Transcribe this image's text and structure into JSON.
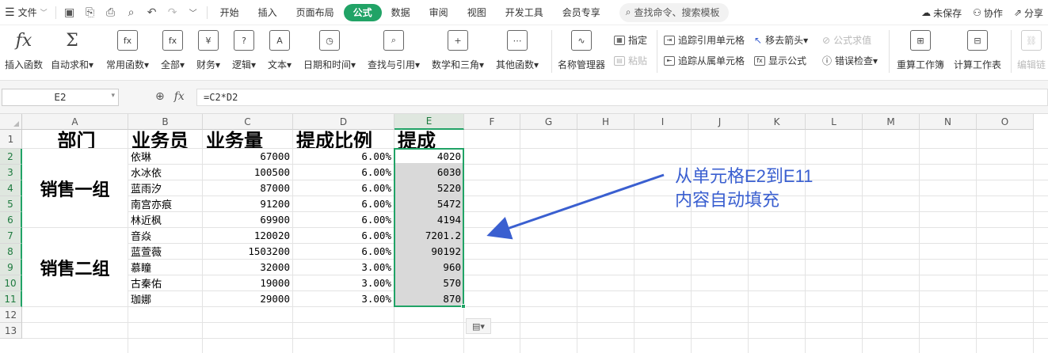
{
  "menubar": {
    "file_label": "文件",
    "tabs": [
      "开始",
      "插入",
      "页面布局",
      "公式",
      "数据",
      "审阅",
      "视图",
      "开发工具",
      "会员专享"
    ],
    "active_tab": "公式",
    "search_placeholder": "查找命令、搜索模板",
    "unsaved_label": "未保存",
    "collab_label": "协作",
    "share_label": "分享"
  },
  "ribbon": {
    "insert_function": "插入函数",
    "autosum": "自动求和",
    "common_functions": "常用函数",
    "all": "全部",
    "finance": "财务",
    "logic": "逻辑",
    "text": "文本",
    "datetime": "日期和时间",
    "lookup": "查找与引用",
    "math": "数学和三角",
    "other": "其他函数",
    "name_manager": "名称管理器",
    "assign": "指定",
    "paste": "粘贴",
    "trace_precedents": "追踪引用单元格",
    "trace_dependents": "追踪从属单元格",
    "remove_arrows": "移去箭头",
    "show_formulas": "显示公式",
    "eval_formula": "公式求值",
    "error_check": "错误检查",
    "recalc_workbook": "重算工作簿",
    "calc_sheet": "计算工作表",
    "edit_links": "编辑链"
  },
  "formula_bar": {
    "name_box": "E2",
    "formula": "=C2*D2"
  },
  "columns": [
    "A",
    "B",
    "C",
    "D",
    "E",
    "F",
    "G",
    "H",
    "I",
    "J",
    "K",
    "L",
    "M",
    "N",
    "O"
  ],
  "rows": [
    "1",
    "2",
    "3",
    "4",
    "5",
    "6",
    "7",
    "8",
    "9",
    "10",
    "11",
    "12",
    "13"
  ],
  "sheet": {
    "headers": [
      "部门",
      "业务员",
      "业务量",
      "提成比例",
      "提成"
    ],
    "groups": [
      "销售一组",
      "销售二组"
    ],
    "records": [
      {
        "name": "依琳",
        "volume": "67000",
        "rate": "6.00%",
        "commission": "4020"
      },
      {
        "name": "水冰依",
        "volume": "100500",
        "rate": "6.00%",
        "commission": "6030"
      },
      {
        "name": "蓝雨汐",
        "volume": "87000",
        "rate": "6.00%",
        "commission": "5220"
      },
      {
        "name": "南宫亦痕",
        "volume": "91200",
        "rate": "6.00%",
        "commission": "5472"
      },
      {
        "name": "林近枫",
        "volume": "69900",
        "rate": "6.00%",
        "commission": "4194"
      },
      {
        "name": "音焱",
        "volume": "120020",
        "rate": "6.00%",
        "commission": "7201.2"
      },
      {
        "name": "蓝萱薇",
        "volume": "1503200",
        "rate": "6.00%",
        "commission": "90192"
      },
      {
        "name": "慕瞳",
        "volume": "32000",
        "rate": "3.00%",
        "commission": "960"
      },
      {
        "name": "古秦佑",
        "volume": "19000",
        "rate": "3.00%",
        "commission": "570"
      },
      {
        "name": "珈娜",
        "volume": "29000",
        "rate": "3.00%",
        "commission": "870"
      }
    ]
  },
  "annotation": {
    "line1": "从单元格E2到E11",
    "line2": "内容自动填充"
  },
  "colors": {
    "accent": "#21a366",
    "annotation": "#3a5fd0"
  }
}
